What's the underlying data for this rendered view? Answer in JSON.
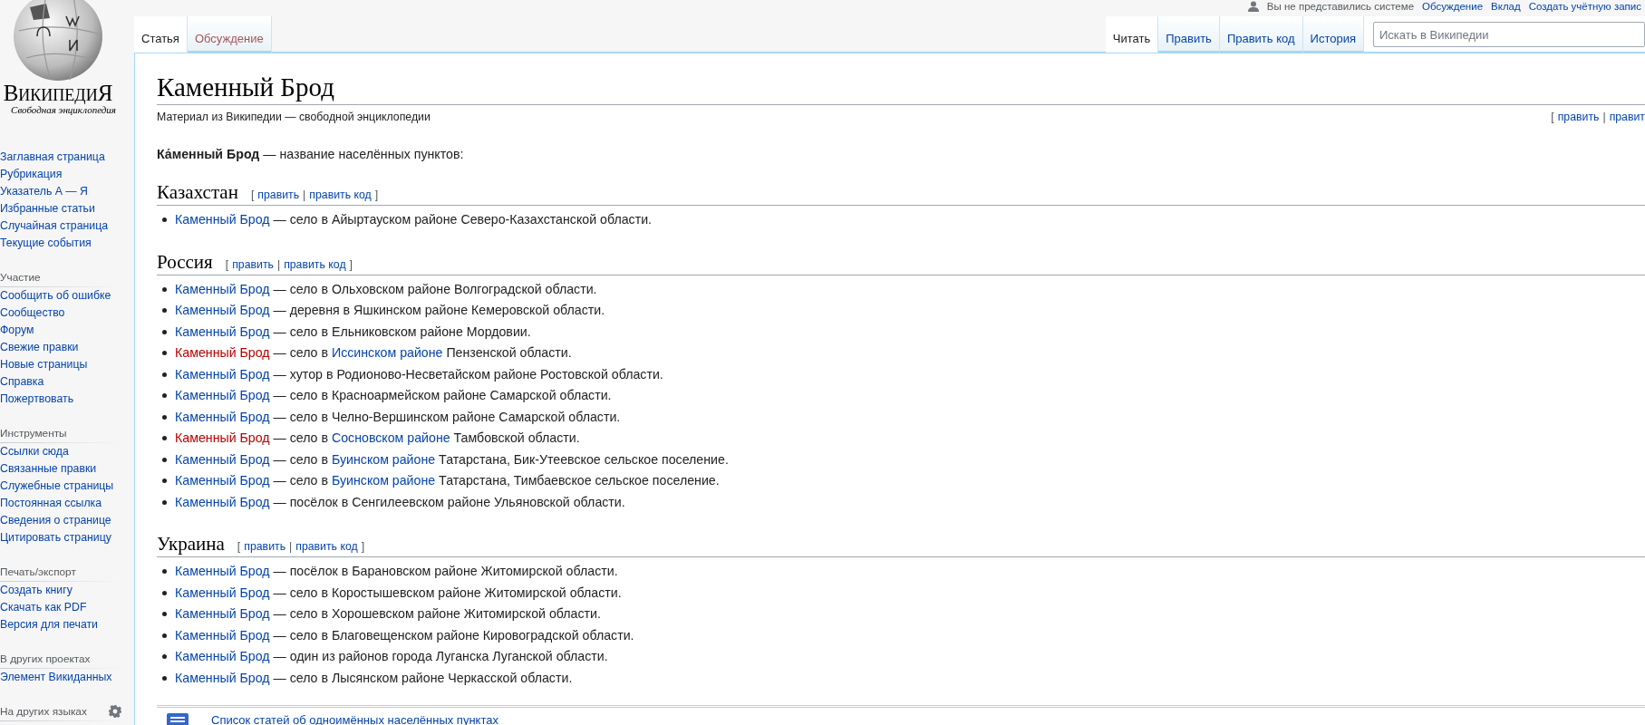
{
  "personal": [
    {
      "kind": "text",
      "label": "Вы не представились системе"
    },
    {
      "kind": "link",
      "label": "Обсуждение"
    },
    {
      "kind": "link",
      "label": "Вклад"
    },
    {
      "kind": "link",
      "label": "Создать учётную запис"
    }
  ],
  "logo": {
    "wordmark": "ВикипедиЯ",
    "tagline": "Свободная энциклопедия"
  },
  "sidebar": [
    {
      "kind": "plain",
      "items": [
        "Заглавная страница",
        "Рубрикация",
        "Указатель А — Я",
        "Избранные статьи",
        "Случайная страница",
        "Текущие события"
      ]
    },
    {
      "heading": "Участие",
      "kind": "plain",
      "items": [
        "Сообщить об ошибке",
        "Сообщество",
        "Форум",
        "Свежие правки",
        "Новые страницы",
        "Справка",
        "Пожертвовать"
      ]
    },
    {
      "heading": "Инструменты",
      "kind": "plain",
      "items": [
        "Ссылки сюда",
        "Связанные правки",
        "Служебные страницы",
        "Постоянная ссылка",
        "Сведения о странице",
        "Цитировать страницу"
      ]
    },
    {
      "heading": "Печать/экспорт",
      "kind": "plain",
      "items": [
        "Создать книгу",
        "Скачать как PDF",
        "Версия для печати"
      ]
    },
    {
      "heading": "В других проектах",
      "kind": "plain",
      "items": [
        "Элемент Викиданных"
      ]
    },
    {
      "heading": "На других языках",
      "kind": "settings"
    }
  ],
  "tabs_left": [
    {
      "label": "Статья",
      "selected": true,
      "new": false
    },
    {
      "label": "Обсуждение",
      "selected": false,
      "new": true
    }
  ],
  "tabs_right": [
    {
      "label": "Читать",
      "selected": true
    },
    {
      "label": "Править",
      "selected": false
    },
    {
      "label": "Править код",
      "selected": false
    },
    {
      "label": "История",
      "selected": false
    }
  ],
  "search": {
    "placeholder": "Искать в Википедии"
  },
  "article": {
    "title": "Каменный Брод",
    "tagline": "Материал из Википедии — свободной энциклопедии",
    "page_edit": {
      "open": "[",
      "links": [
        "править",
        "правит"
      ],
      "sep": "|"
    },
    "intro": "**Ка́менный Брод** — название населённых пунктов:",
    "sections": [
      {
        "heading": "Казахстан",
        "edit": {
          "open": "[",
          "links": [
            "править",
            "править код"
          ],
          "sep": "|",
          "close": "]"
        },
        "items": [
          [
            {
              "kind": "link",
              "text": "Каменный Брод"
            },
            {
              "kind": "text",
              "text": " — село в Айыртауском районе Северо-Казахстанской области."
            }
          ]
        ]
      },
      {
        "heading": "Россия",
        "edit": {
          "open": "[",
          "links": [
            "править",
            "править код"
          ],
          "sep": "|",
          "close": "]"
        },
        "items": [
          [
            {
              "kind": "link",
              "text": "Каменный Брод"
            },
            {
              "kind": "text",
              "text": " — село в Ольховском районе Волгоградской области."
            }
          ],
          [
            {
              "kind": "link",
              "text": "Каменный Брод"
            },
            {
              "kind": "text",
              "text": " — деревня в Яшкинском районе Кемеровской области."
            }
          ],
          [
            {
              "kind": "link",
              "text": "Каменный Брод"
            },
            {
              "kind": "text",
              "text": " — село в Ельниковском районе Мордовии."
            }
          ],
          [
            {
              "kind": "new",
              "text": "Каменный Брод"
            },
            {
              "kind": "text",
              "text": " — село в "
            },
            {
              "kind": "link",
              "text": "Иссинском районе"
            },
            {
              "kind": "text",
              "text": " Пензенской области."
            }
          ],
          [
            {
              "kind": "link",
              "text": "Каменный Брод"
            },
            {
              "kind": "text",
              "text": " — хутор в Родионово-Несветайском районе Ростовской области."
            }
          ],
          [
            {
              "kind": "link",
              "text": "Каменный Брод"
            },
            {
              "kind": "text",
              "text": " — село в Красноармейском районе Самарской области."
            }
          ],
          [
            {
              "kind": "link",
              "text": "Каменный Брод"
            },
            {
              "kind": "text",
              "text": " — село в Челно-Вершинском районе Самарской области."
            }
          ],
          [
            {
              "kind": "new",
              "text": "Каменный Брод"
            },
            {
              "kind": "text",
              "text": " — село в "
            },
            {
              "kind": "link",
              "text": "Сосновском районе"
            },
            {
              "kind": "text",
              "text": " Тамбовской области."
            }
          ],
          [
            {
              "kind": "link",
              "text": "Каменный Брод"
            },
            {
              "kind": "text",
              "text": " — село в "
            },
            {
              "kind": "link",
              "text": "Буинском районе"
            },
            {
              "kind": "text",
              "text": " Татарстана, Бик-Утеевское сельское поселение."
            }
          ],
          [
            {
              "kind": "link",
              "text": "Каменный Брод"
            },
            {
              "kind": "text",
              "text": " — село в "
            },
            {
              "kind": "link",
              "text": "Буинском районе"
            },
            {
              "kind": "text",
              "text": " Татарстана, Тимбаевское сельское поселение."
            }
          ],
          [
            {
              "kind": "link",
              "text": "Каменный Брод"
            },
            {
              "kind": "text",
              "text": " — посёлок в Сенгилеевском районе Ульяновской области."
            }
          ]
        ]
      },
      {
        "heading": "Украина",
        "edit": {
          "open": "[",
          "links": [
            "править",
            "править код"
          ],
          "sep": "|",
          "close": "]"
        },
        "items": [
          [
            {
              "kind": "link",
              "text": "Каменный Брод"
            },
            {
              "kind": "text",
              "text": " — посёлок в Барановском районе Житомирской области."
            }
          ],
          [
            {
              "kind": "link",
              "text": "Каменный Брод"
            },
            {
              "kind": "text",
              "text": " — село в Коростышевском районе Житомирской области."
            }
          ],
          [
            {
              "kind": "link",
              "text": "Каменный Брод"
            },
            {
              "kind": "text",
              "text": " — село в Хорошевском районе Житомирской области."
            }
          ],
          [
            {
              "kind": "link",
              "text": "Каменный Брод"
            },
            {
              "kind": "text",
              "text": " — село в Благовещенском районе Кировоградской области."
            }
          ],
          [
            {
              "kind": "link",
              "text": "Каменный Брод"
            },
            {
              "kind": "text",
              "text": " — один из районов города Луганска Луганской области."
            }
          ],
          [
            {
              "kind": "link",
              "text": "Каменный Брод"
            },
            {
              "kind": "text",
              "text": " — село в Лысянском районе Черкасской области."
            }
          ]
        ]
      }
    ],
    "disambig": {
      "link": "Список статей об одноимённых населённых пунктах"
    }
  }
}
